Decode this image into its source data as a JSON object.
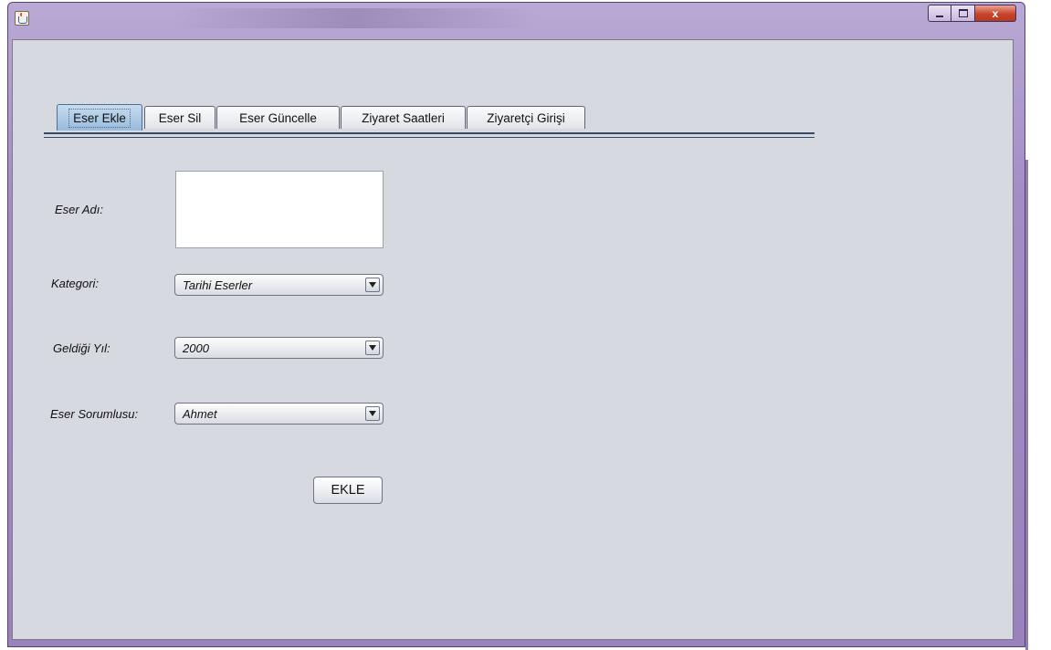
{
  "window": {
    "title": "",
    "controls": {
      "minimize": "",
      "maximize": "",
      "close": "x"
    }
  },
  "tabs": [
    {
      "label": "Eser Ekle",
      "active": true
    },
    {
      "label": "Eser Sil",
      "active": false
    },
    {
      "label": "Eser Güncelle",
      "active": false
    },
    {
      "label": "Ziyaret Saatleri",
      "active": false
    },
    {
      "label": "Ziyaretçi Girişi",
      "active": false
    }
  ],
  "form": {
    "eser_adi": {
      "label": "Eser Adı:",
      "value": ""
    },
    "kategori": {
      "label": "Kategori:",
      "selected": "Tarihi Eserler"
    },
    "geldigi_yil": {
      "label": "Geldiği Yıl:",
      "selected": "2000"
    },
    "eser_sorumlusu": {
      "label": "Eser Sorumlusu:",
      "selected": "Ahmet"
    },
    "submit_label": "EKLE"
  },
  "colors": {
    "frame": "#a48dc7",
    "client_bg": "#d6d9df",
    "active_tab": "#97bbdc",
    "close_button": "#c8442b"
  }
}
